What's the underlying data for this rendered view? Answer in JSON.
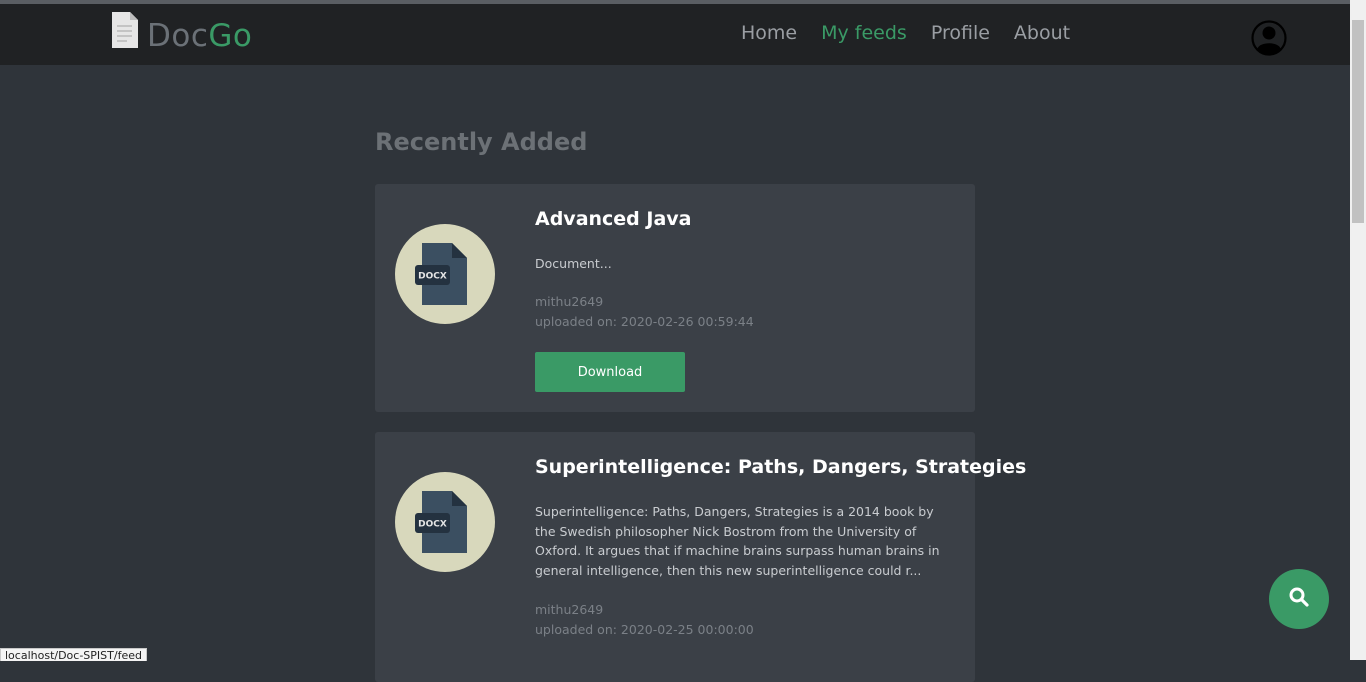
{
  "brand": {
    "doc": "Doc",
    "go": "Go"
  },
  "nav": {
    "items": [
      {
        "label": "Home"
      },
      {
        "label": "My feeds"
      },
      {
        "label": "Profile"
      },
      {
        "label": "About"
      }
    ],
    "active": "My feeds"
  },
  "main": {
    "section_title": "Recently Added",
    "cards": [
      {
        "badge": "DOCX",
        "title": "Advanced Java",
        "description": "Document...",
        "author": "mithu2649",
        "uploaded": "uploaded on: 2020-02-26 00:59:44",
        "button": "Download"
      },
      {
        "badge": "DOCX",
        "title": "Superintelligence: Paths, Dangers, Strategies",
        "description": "Superintelligence: Paths, Dangers, Strategies is a 2014 book by the Swedish philosopher Nick Bostrom from the University of Oxford. It argues that if machine brains surpass human brains in general intelligence, then this new superintelligence could r...",
        "author": "mithu2649",
        "uploaded": "uploaded on: 2020-02-25 00:00:00"
      }
    ]
  },
  "status_url": "localhost/Doc-SPIST/feed",
  "colors": {
    "accent": "#3a9a66",
    "navbar": "#202224",
    "background": "#2f343a",
    "card": "#3b4047"
  },
  "icons": {
    "logo": "document-icon",
    "account": "user-circle-icon",
    "file": "docx-file-icon",
    "search": "search-icon"
  }
}
